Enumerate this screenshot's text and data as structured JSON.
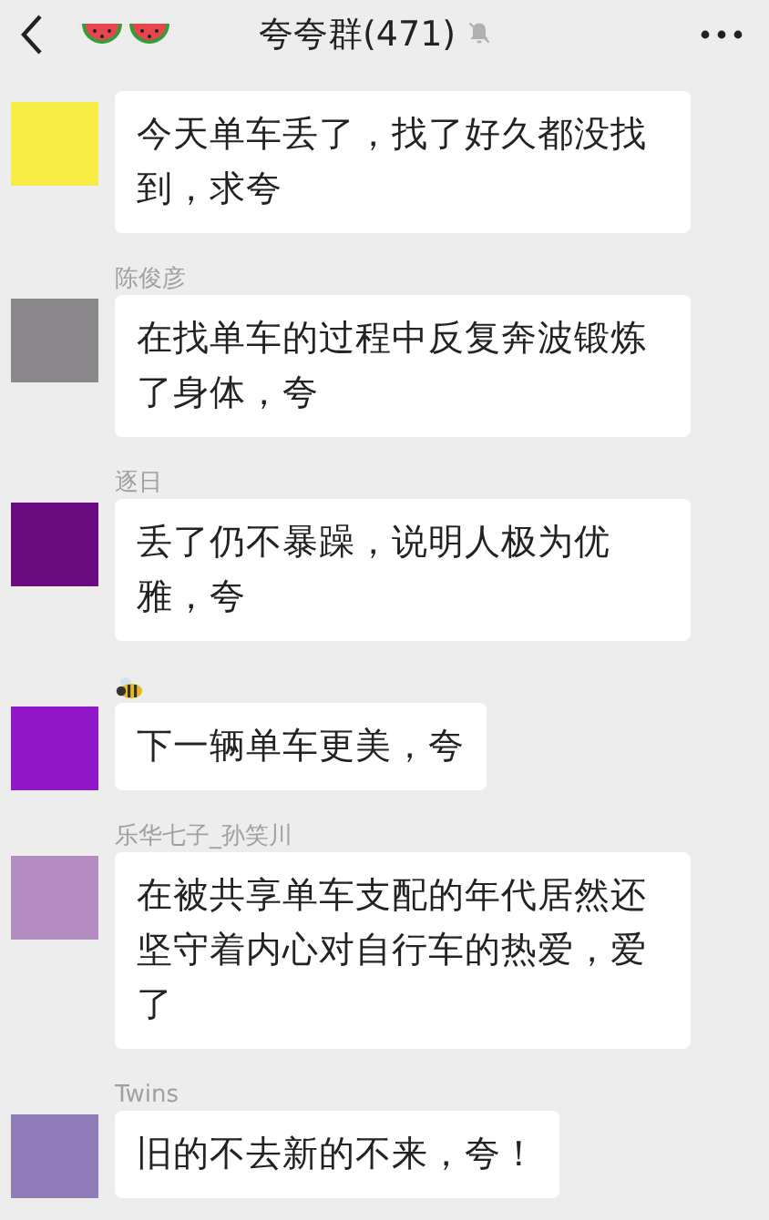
{
  "header": {
    "title": "夸夸群(471)",
    "muted": true
  },
  "messages": [
    {
      "kind": "cut",
      "color": "#f5ec45",
      "text": "今天单车丢了，找了好久都没找到，求夸"
    },
    {
      "kind": "named",
      "sender": "陈俊彦",
      "color": "#8a888a",
      "text": "在找单车的过程中反复奔波锻炼了身体，夸"
    },
    {
      "kind": "named",
      "sender": "逐日",
      "color": "#6a0c80",
      "text": "丢了仍不暴躁，说明人极为优雅，夸"
    },
    {
      "kind": "emoji",
      "color": "#9118c8",
      "text": "下一辆单车更美，夸"
    },
    {
      "kind": "named",
      "sender": "乐华七子_孙笑川",
      "color": "#b48cc0",
      "text": "在被共享单车支配的年代居然还坚守着内心对自行车的热爱，爱了"
    },
    {
      "kind": "named",
      "sender": "Twins",
      "color": "#8f7cb8",
      "text": "旧的不去新的不来，夸！"
    }
  ]
}
